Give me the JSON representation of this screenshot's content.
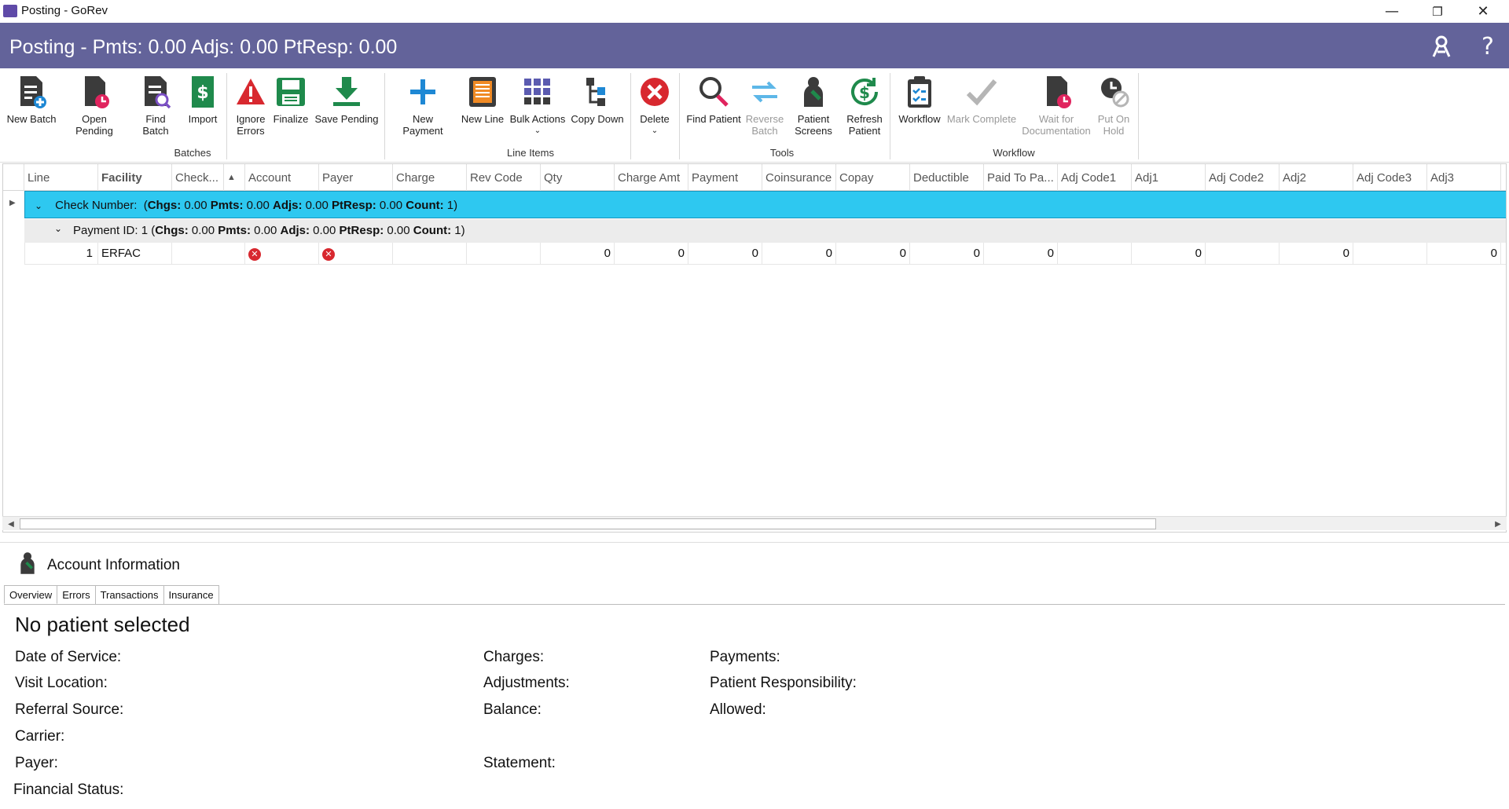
{
  "window": {
    "title": "Posting - GoRev"
  },
  "header": {
    "title": "Posting - Pmts: 0.00 Adjs: 0.00 PtResp: 0.00"
  },
  "ribbon": {
    "batches": {
      "group_label": "Batches",
      "new_batch": "New Batch",
      "open_pending": "Open Pending",
      "find_batch": "Find Batch",
      "import": "Import",
      "ignore_errors_1": "Ignore",
      "ignore_errors_2": "Errors",
      "finalize": "Finalize",
      "save_pending": "Save Pending"
    },
    "line_items": {
      "group_label": "Line Items",
      "new_payment": "New Payment",
      "new_line": "New Line",
      "bulk_actions": "Bulk Actions",
      "copy_down": "Copy Down",
      "delete": "Delete"
    },
    "tools": {
      "group_label": "Tools",
      "find_patient": "Find Patient",
      "reverse_batch_1": "Reverse",
      "reverse_batch_2": "Batch",
      "patient_screens_1": "Patient",
      "patient_screens_2": "Screens",
      "refresh_patient_1": "Refresh",
      "refresh_patient_2": "Patient"
    },
    "workflow": {
      "group_label": "Workflow",
      "workflow": "Workflow",
      "mark_complete": "Mark Complete",
      "wait_doc_1": "Wait for",
      "wait_doc_2": "Documentation",
      "put_on_hold_1": "Put On",
      "put_on_hold_2": "Hold"
    }
  },
  "grid": {
    "columns": [
      "Line",
      "Facility",
      "Check...",
      "Account",
      "Payer",
      "Charge",
      "Rev Code",
      "Qty",
      "Charge Amt",
      "Payment",
      "Coinsurance",
      "Copay",
      "Deductible",
      "Paid To Pa...",
      "Adj Code1",
      "Adj1",
      "Adj Code2",
      "Adj2",
      "Adj Code3",
      "Adj3"
    ],
    "group_row": {
      "prefix": "Check Number:",
      "open": "(",
      "chgs_label": "Chgs:",
      "chgs": "0.00",
      "pmts_label": "Pmts:",
      "pmts": "0.00",
      "adjs_label": "Adjs:",
      "adjs": "0.00",
      "ptresp_label": "PtResp:",
      "ptresp": "0.00",
      "count_label": "Count:",
      "count": "1",
      "close": ")"
    },
    "sub_row": {
      "prefix": "Payment ID: 1",
      "open": "(",
      "chgs_label": "Chgs:",
      "chgs": "0.00",
      "pmts_label": "Pmts:",
      "pmts": "0.00",
      "adjs_label": "Adjs:",
      "adjs": "0.00",
      "ptresp_label": "PtResp:",
      "ptresp": "0.00",
      "count_label": "Count:",
      "count": "1",
      "close": ")"
    },
    "row": {
      "line": "1",
      "facility": "ERFAC",
      "qty": "0",
      "charge_amt": "0",
      "payment": "0",
      "coinsurance": "0",
      "copay": "0",
      "deductible": "0",
      "paid_to_pa": "0",
      "adj1": "0",
      "adj2": "0",
      "adj3": "0"
    }
  },
  "account": {
    "title": "Account Information",
    "tabs": [
      "Overview",
      "Errors",
      "Transactions",
      "Insurance"
    ],
    "no_patient": "No patient selected",
    "fields": {
      "date_of_service": "Date of Service:",
      "visit_location": "Visit Location:",
      "referral_source": "Referral Source:",
      "carrier": "Carrier:",
      "payer": "Payer:",
      "financial_status": "Financial Status:",
      "charges": "Charges:",
      "adjustments": "Adjustments:",
      "balance": "Balance:",
      "statement": "Statement:",
      "payments": "Payments:",
      "patient_responsibility": "Patient Responsibility:",
      "allowed": "Allowed:"
    }
  },
  "colors": {
    "header_bg": "#63639a",
    "group_row_bg": "#2ec8f0",
    "error_red": "#d8282f",
    "accent_blue": "#1e88d4",
    "green": "#1f8a4c"
  }
}
